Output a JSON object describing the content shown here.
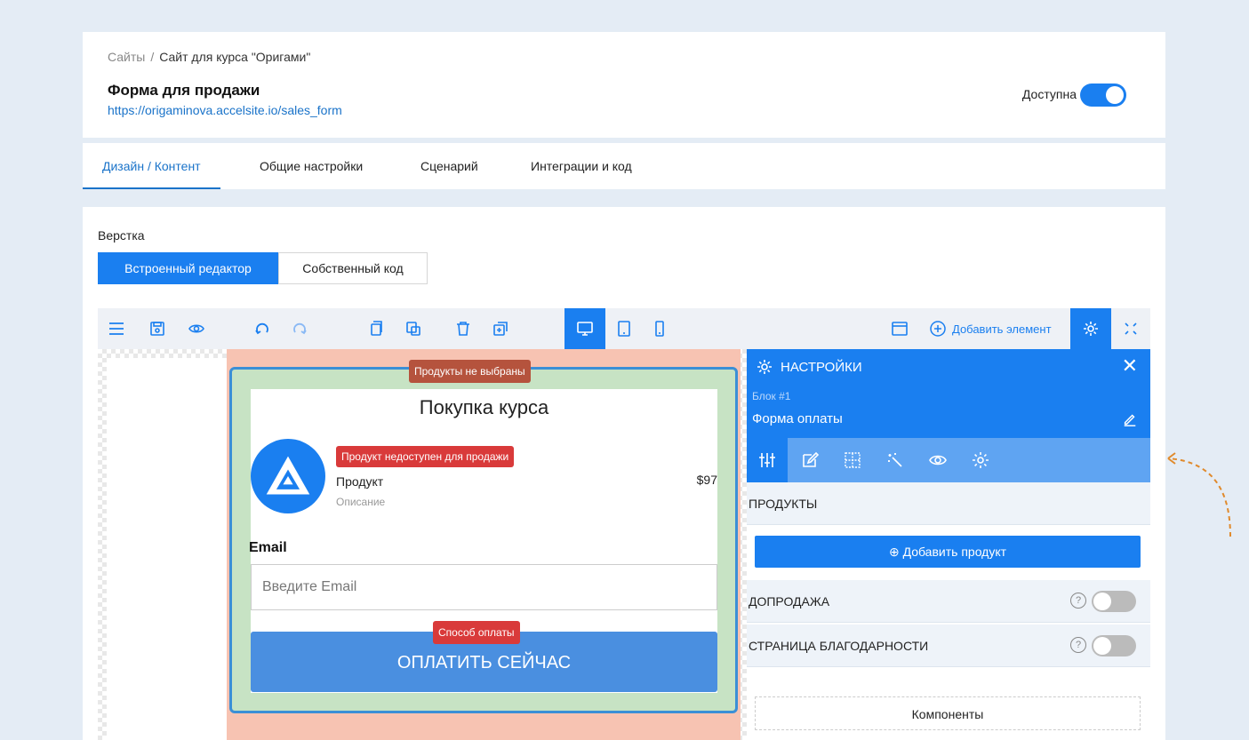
{
  "breadcrumb": {
    "sites": "Сайты",
    "separator": "/",
    "current": "Сайт для курса \"Оригами\""
  },
  "page": {
    "title": "Форма для продажи",
    "url": "https://origaminova.accelsite.io/sales_form",
    "available_label": "Доступна",
    "available": true
  },
  "tabs": [
    {
      "label": "Дизайн / Контент",
      "active": true
    },
    {
      "label": "Общие настройки",
      "active": false
    },
    {
      "label": "Сценарий",
      "active": false
    },
    {
      "label": "Интеграции и код",
      "active": false
    }
  ],
  "layout": {
    "label": "Верстка",
    "builtin": "Встроенный редактор",
    "own_code": "Собственный код"
  },
  "toolbar": {
    "add_element": "Добавить элемент"
  },
  "form": {
    "no_products_badge": "Продукты не выбраны",
    "title": "Покупка курса",
    "product_unavailable": "Продукт недоступен для продажи",
    "product_name": "Продукт",
    "product_price": "$97",
    "product_description": "Описание",
    "email_label": "Email",
    "email_placeholder": "Введите Email",
    "payment_method_badge": "Способ оплаты",
    "pay_button": "ОПЛАТИТЬ СЕЙЧАС"
  },
  "panel": {
    "title": "НАСТРОЙКИ",
    "block": "Блок #1",
    "form_name": "Форма оплаты",
    "products": "ПРОДУКТЫ",
    "add_product": "Добавить продукт",
    "upsell": "ДОПРОДАЖА",
    "thank_you": "СТРАНИЦА БЛАГОДАРНОСТИ",
    "help": "?",
    "components": "Компоненты"
  },
  "colors": {
    "accent": "#1a7ff0",
    "badge_red": "#d93a3a",
    "badge_brown": "#b5533d",
    "canvas_green": "#c7e3c4",
    "canvas_salmon": "#f7c3b2"
  }
}
